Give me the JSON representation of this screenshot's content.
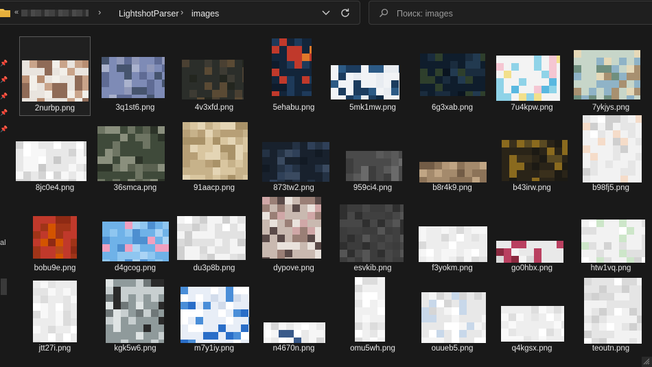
{
  "breadcrumb": {
    "prefix": "«",
    "hidden_segment": "",
    "segments": [
      "LightshotParser",
      "images"
    ]
  },
  "search": {
    "placeholder": "Поиск: images",
    "value": ""
  },
  "nav": {
    "partial_label": "al"
  },
  "icons": {
    "folder": "folder-icon",
    "chevron_down": "chevron-down-icon",
    "refresh": "refresh-icon",
    "search": "search-icon",
    "pin": "pin-icon",
    "resize_grip": "resize-grip-icon"
  },
  "colors": {
    "background": "#191919",
    "folder_yellow": "#f2c14e",
    "text": "#e6e6e6",
    "placeholder": "#9a9a9a"
  },
  "files": [
    "2nurbp.png",
    "3q1st6.png",
    "4v3xfd.png",
    "5ehabu.png",
    "5mk1mw.png",
    "6g3xab.png",
    "7u4kpw.png",
    "7ykjys.png",
    "8jc0e4.png",
    "36smca.png",
    "91aacp.png",
    "873tw2.png",
    "959ci4.png",
    "b8r4k9.png",
    "b43irw.png",
    "b98fj5.png",
    "bobu9e.png",
    "d4gcog.png",
    "du3p8b.png",
    "dypove.png",
    "esvkib.png",
    "f3yokm.png",
    "go0hbx.png",
    "htw1vq.png",
    "jtt27i.png",
    "kgk5w6.png",
    "m7y1iy.png",
    "n4670n.png",
    "omu5wh.png",
    "ouueb5.png",
    "q4kgsx.png",
    "teoutn.png"
  ],
  "selected_index": 0
}
